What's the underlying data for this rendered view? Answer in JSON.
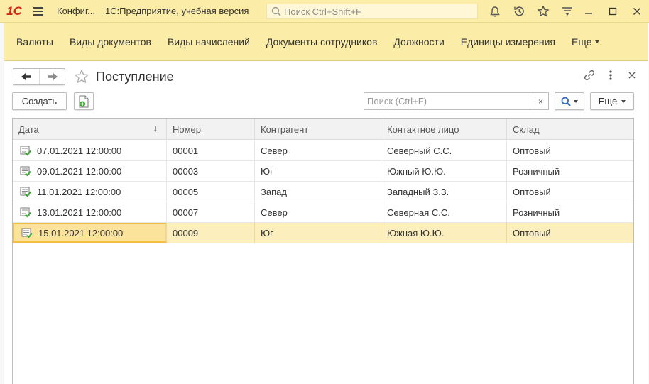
{
  "titlebar": {
    "logo": "1С",
    "config_short": "Конфиг...",
    "app_name": "1С:Предприятие, учебная версия",
    "search_placeholder": "Поиск Ctrl+Shift+F"
  },
  "sections": {
    "items": [
      "Валюты",
      "Виды документов",
      "Виды начислений",
      "Документы сотрудников",
      "Должности",
      "Единицы измерения"
    ],
    "more_label": "Еще"
  },
  "form": {
    "title": "Поступление",
    "create_label": "Создать",
    "search_placeholder": "Поиск (Ctrl+F)",
    "search_clear": "×",
    "more_label": "Еще"
  },
  "table": {
    "columns": [
      "Дата",
      "Номер",
      "Контрагент",
      "Контактное лицо",
      "Склад"
    ],
    "sort_indicator": "↓",
    "rows": [
      [
        "07.01.2021 12:00:00",
        "00001",
        "Север",
        "Северный С.С.",
        "Оптовый"
      ],
      [
        "09.01.2021 12:00:00",
        "00003",
        "Юг",
        "Южный Ю.Ю.",
        "Розничный"
      ],
      [
        "11.01.2021 12:00:00",
        "00005",
        "Запад",
        "Западный З.З.",
        "Оптовый"
      ],
      [
        "13.01.2021 12:00:00",
        "00007",
        "Север",
        "Северная С.С.",
        "Розничный"
      ],
      [
        "15.01.2021 12:00:00",
        "00009",
        "Юг",
        "Южная Ю.Ю.",
        "Оптовый"
      ]
    ],
    "selected_row": 4
  },
  "colors": {
    "panel_yellow": "#fbeda8",
    "selection": "#fcefbd",
    "active_cell_border": "#f0c040",
    "logo_red": "#d02a1a",
    "icon_green": "#3aa435"
  }
}
